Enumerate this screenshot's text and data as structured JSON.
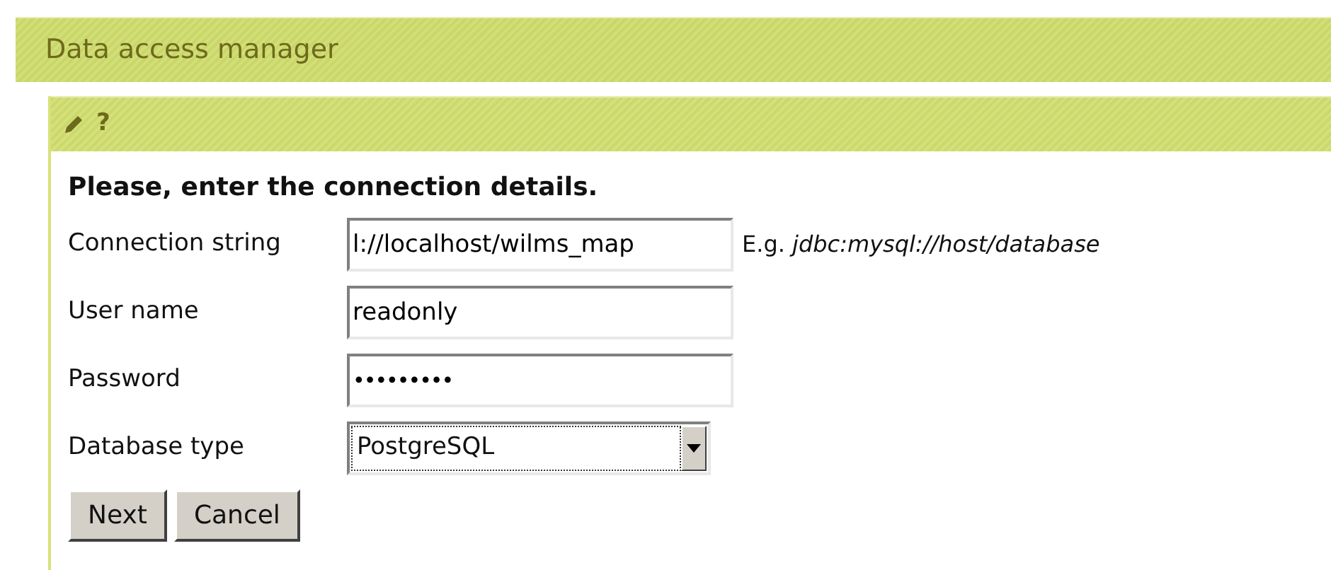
{
  "window": {
    "title": "Data access manager"
  },
  "toolbar": {
    "icons": [
      {
        "kind": "pencil"
      },
      {
        "kind": "help",
        "text": "?"
      }
    ]
  },
  "form": {
    "heading": "Please, enter the connection details.",
    "fields": [
      {
        "kind": "text",
        "label": "Connection string",
        "value": "l://localhost/wilms_map",
        "hint": "E.g. *jdbc:mysql://host/database*"
      },
      {
        "kind": "text",
        "label": "User name",
        "value": "readonly"
      },
      {
        "kind": "password",
        "label": "Password",
        "value": "•••••••••"
      },
      {
        "kind": "select",
        "label": "Database type",
        "value": "PostgreSQL"
      }
    ]
  },
  "buttons": [
    "Next",
    "Cancel"
  ]
}
